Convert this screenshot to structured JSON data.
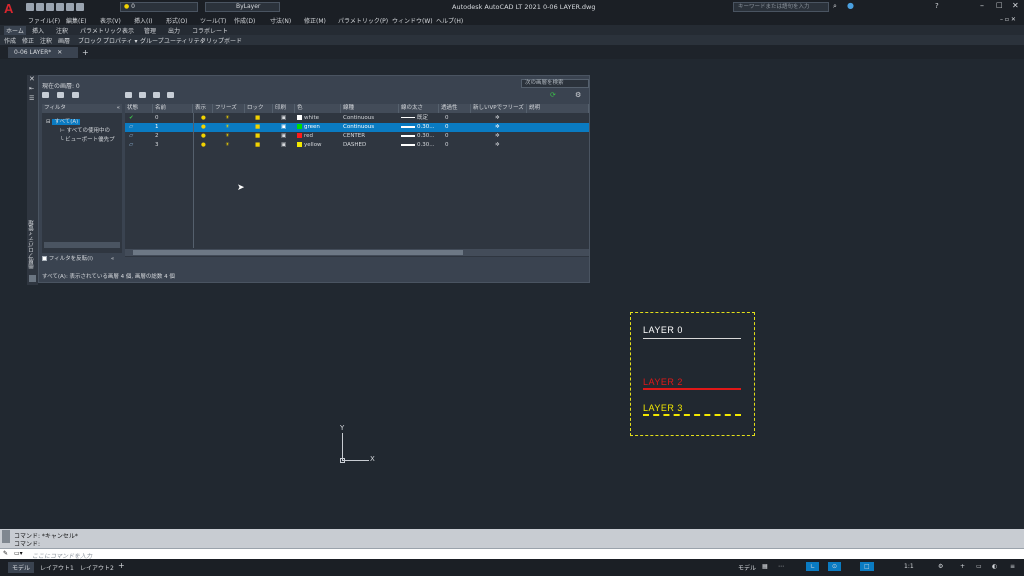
{
  "app": {
    "title": "Autodesk AutoCAD LT 2021    0-06 LAYER.dwg",
    "search_placeholder": "キーワードまたは語句を入力",
    "layer_combo_value": "0",
    "linetype_combo_value": "ByLayer"
  },
  "menu": [
    "ファイル(F)",
    "編集(E)",
    "表示(V)",
    "挿入(I)",
    "形式(O)",
    "ツール(T)",
    "作成(D)",
    "寸法(N)",
    "修正(M)",
    "パラメトリック(P)",
    "ウィンドウ(W)",
    "ヘルプ(H)"
  ],
  "ribbon_tabs": [
    "ホーム",
    "挿入",
    "注釈",
    "パラメトリック",
    "表示",
    "管理",
    "出力",
    "コラボレート"
  ],
  "ribbon_panels": [
    "作成",
    "修正",
    "注釈",
    "画層",
    "ブロック",
    "プロパティ ▾",
    "グループ",
    "ユーティリティ",
    "クリップボード"
  ],
  "file_tab": "0-06 LAYER*",
  "layer_manager": {
    "current_layer": "現在の画層: 0",
    "search_placeholder": "次の画層を検索",
    "filter_header": "フィルタ",
    "filter_tree": [
      "すべて(A)",
      "すべての使用中の",
      "ビューポート優先プ"
    ],
    "invert_filter": "フィルタを反転(I)",
    "columns": [
      "状態",
      "名前",
      "表示",
      "フリーズ",
      "ロック",
      "印刷",
      "色",
      "線種",
      "線の太さ",
      "透過性",
      "新しいVPでフリーズ",
      "説明"
    ],
    "layers": [
      {
        "name": "0",
        "color_name": "white",
        "color": "#ffffff",
        "linetype": "Continuous",
        "lineweight": "既定",
        "transparency": "0",
        "current": true
      },
      {
        "name": "1",
        "color_name": "green",
        "color": "#00e000",
        "linetype": "Continuous",
        "lineweight": "0.30...",
        "transparency": "0",
        "current": false
      },
      {
        "name": "2",
        "color_name": "red",
        "color": "#ff1a1a",
        "linetype": "CENTER",
        "lineweight": "0.30...",
        "transparency": "0",
        "current": false
      },
      {
        "name": "3",
        "color_name": "yellow",
        "color": "#f2e800",
        "linetype": "DASHED",
        "lineweight": "0.30...",
        "transparency": "0",
        "current": false
      }
    ],
    "status": "すべて(A): 表示されている画層 4 個, 画層の総数 4 個",
    "vertical_title": "画層プロパティ管理"
  },
  "drawing": {
    "labels": [
      {
        "text": "LAYER 0",
        "color": "#ffffff"
      },
      {
        "text": "LAYER 2",
        "color": "#e01818"
      },
      {
        "text": "LAYER 3",
        "color": "#f2e800"
      }
    ],
    "ucs_x": "X",
    "ucs_y": "Y"
  },
  "command": {
    "line1": "コマンド:  *キャンセル*",
    "line2": "コマンド:",
    "placeholder": "ここにコマンドを入力"
  },
  "layout_tabs": [
    "モデル",
    "レイアウト1",
    "レイアウト2"
  ],
  "model_label": "モデル",
  "scale": "1:1"
}
